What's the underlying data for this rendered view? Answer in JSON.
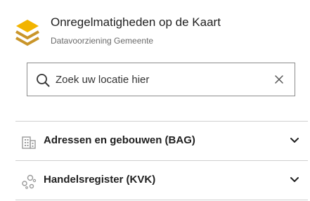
{
  "header": {
    "title": "Onregelmatigheden op de Kaart",
    "subtitle": "Datavoorziening Gemeente",
    "logo_icon": "stacked-layers-icon",
    "logo_colors": [
      "#f2b400",
      "#c9952a"
    ]
  },
  "search": {
    "placeholder": "Zoek uw locatie hier",
    "value": "",
    "search_icon": "search-icon",
    "clear_icon": "close-icon"
  },
  "panels": [
    {
      "label": "Adressen en gebouwen (BAG)",
      "icon": "building-icon",
      "expanded": false
    },
    {
      "label": "Handelsregister (KVK)",
      "icon": "network-nodes-icon",
      "expanded": false
    }
  ],
  "colors": {
    "text": "#1f1f1f",
    "muted": "#6a6a6a",
    "border": "#8c8c8c",
    "divider": "#cfcfcf",
    "icon_grey": "#9a9a9a"
  }
}
